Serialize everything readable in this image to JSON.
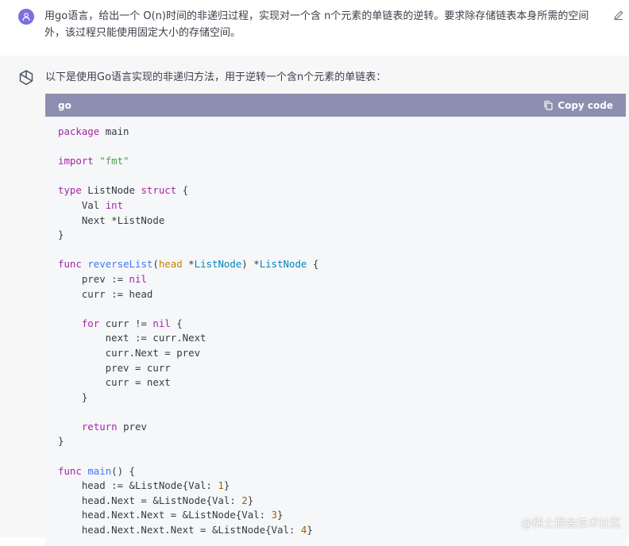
{
  "user": {
    "prompt": "用go语言，给出一个 O(n)时间的非递归过程，实现对一个含 n个元素的单链表的逆转。要求除存储链表本身所需的空间外，该过程只能使用固定大小的存储空间。"
  },
  "assistant": {
    "intro": "以下是使用Go语言实现的非递归方法，用于逆转一个含n个元素的单链表："
  },
  "code": {
    "language": "go",
    "copy_label": "Copy code",
    "lines": [
      "package main",
      "",
      "import \"fmt\"",
      "",
      "type ListNode struct {",
      "    Val int",
      "    Next *ListNode",
      "}",
      "",
      "func reverseList(head *ListNode) *ListNode {",
      "    prev := nil",
      "    curr := head",
      "",
      "    for curr != nil {",
      "        next := curr.Next",
      "        curr.Next = prev",
      "        prev = curr",
      "        curr = next",
      "    }",
      "",
      "    return prev",
      "}",
      "",
      "func main() {",
      "    head := &ListNode{Val: 1}",
      "    head.Next = &ListNode{Val: 2}",
      "    head.Next.Next = &ListNode{Val: 3}",
      "    head.Next.Next.Next = &ListNode{Val: 4}"
    ]
  },
  "watermark": "@稀土掘金技术社区",
  "colors": {
    "code_header": "#8d8fb0",
    "user_avatar": "#7c6fe0",
    "keyword": "#a626a4",
    "function": "#4078f2",
    "type": "#0184bc",
    "string": "#50a14f",
    "number": "#986801"
  }
}
